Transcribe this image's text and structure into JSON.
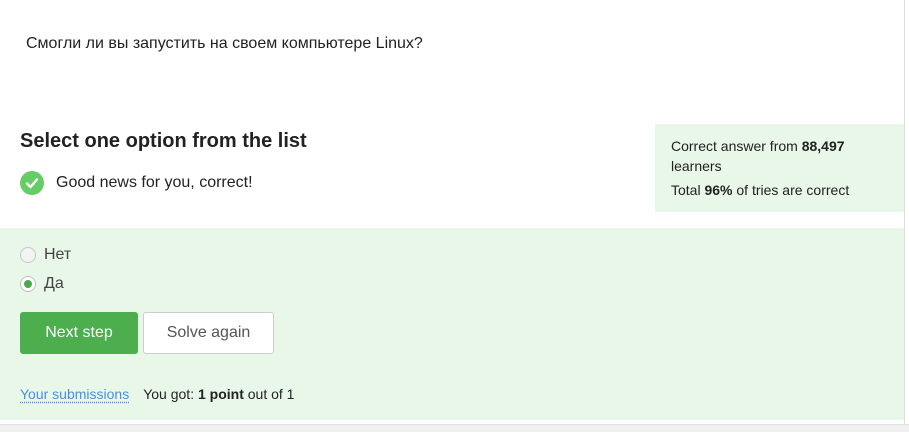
{
  "question": {
    "text": "Смогли ли вы запустить на своем компьютере Linux?"
  },
  "task": {
    "title": "Select one option from the list",
    "feedback": "Good news for you, correct!"
  },
  "stats": {
    "correct_prefix": "Correct answer from ",
    "learners_count": "88,497",
    "learners_suffix": "learners",
    "total_prefix": "Total ",
    "percent": "96%",
    "percent_suffix": " of tries are correct"
  },
  "options": [
    {
      "label": "Нет",
      "selected": false
    },
    {
      "label": "Да",
      "selected": true
    }
  ],
  "buttons": {
    "next": "Next step",
    "again": "Solve again"
  },
  "footer": {
    "submissions_link": "Your submissions",
    "score_prefix": "You got: ",
    "score_value": "1 point",
    "score_suffix": " out of 1"
  },
  "colors": {
    "success_green": "#4cae4c",
    "panel_green": "#e9f7e9",
    "link_blue": "#4a90e2"
  },
  "icons": {
    "feedback": "check-circle-icon"
  }
}
